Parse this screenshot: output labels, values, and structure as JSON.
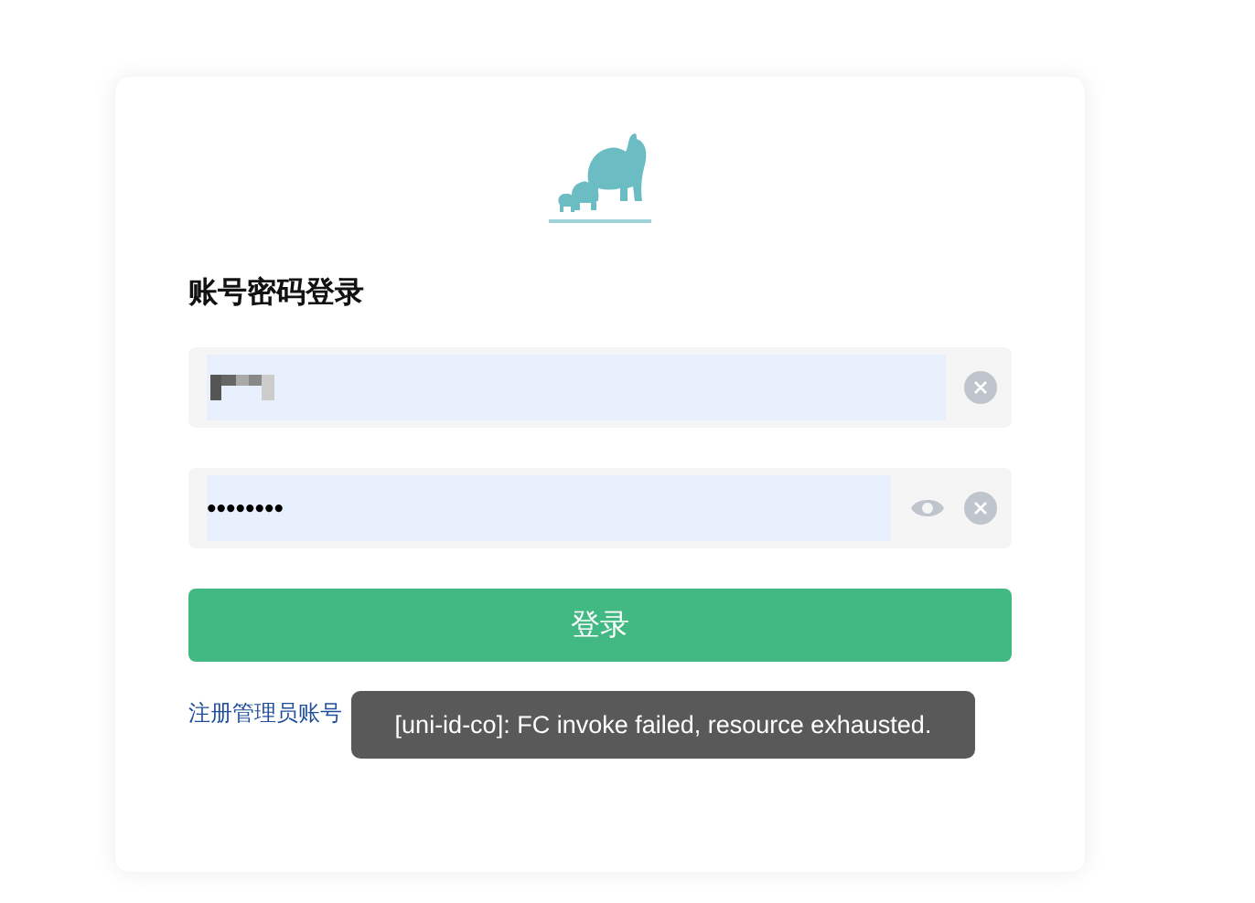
{
  "login_card": {
    "title": "账号密码登录",
    "fields": [
      {
        "kind": "username",
        "clearable": true
      },
      {
        "kind": "password",
        "value": "••••••••",
        "show_toggle": true,
        "clearable": true
      }
    ],
    "submit_button": "登录",
    "register_link": "注册管理员账号"
  },
  "toast": {
    "message": "[uni-id-co]: FC invoke failed, resource exhausted."
  }
}
